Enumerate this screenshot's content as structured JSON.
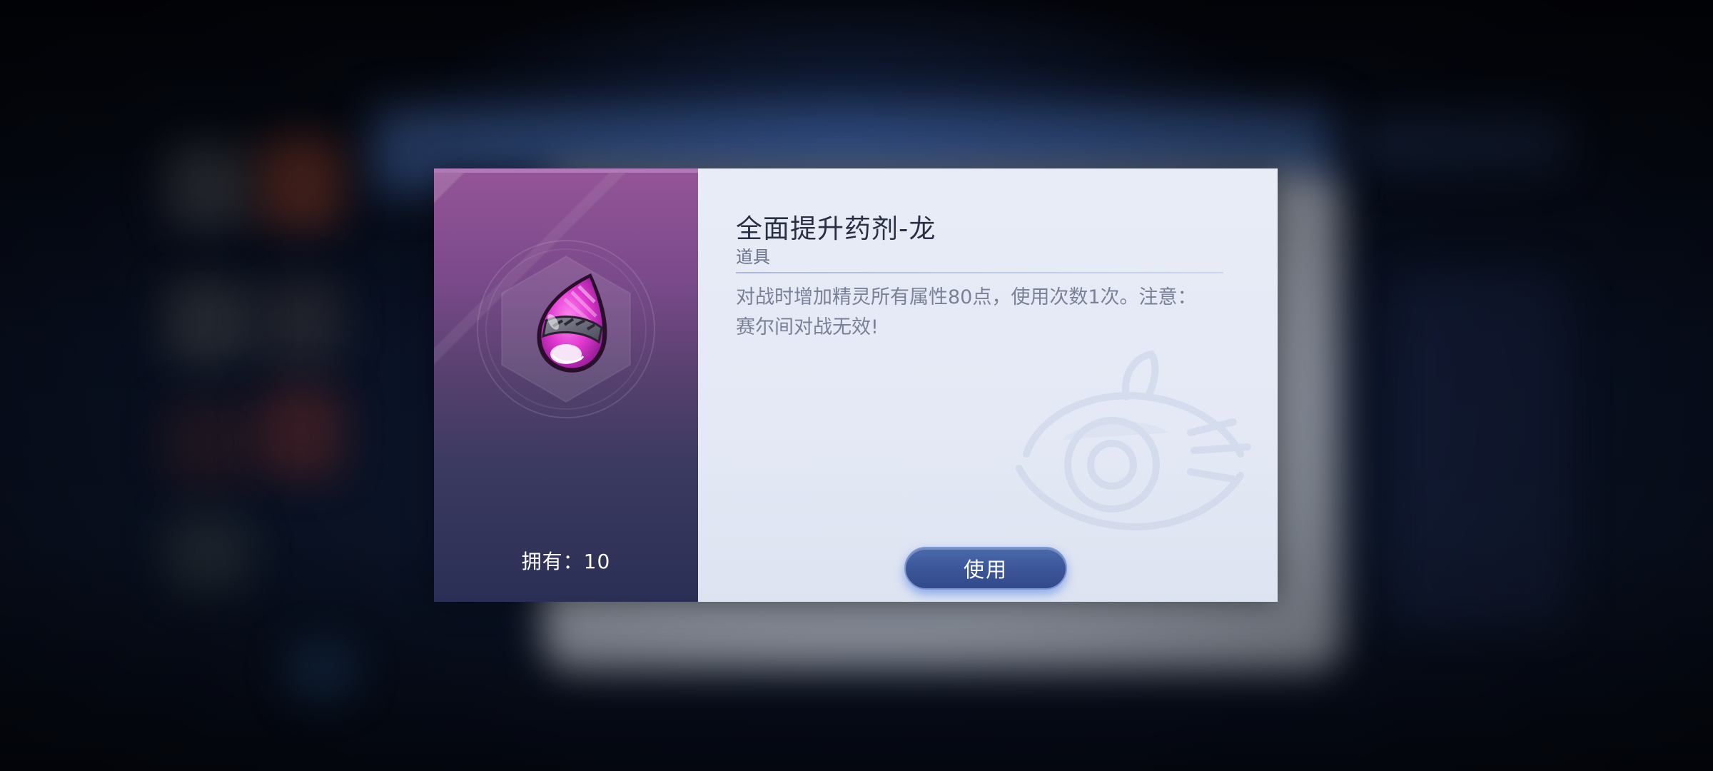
{
  "item": {
    "name": "全面提升药剂-龙",
    "category": "道具",
    "description": "对战时增加精灵所有属性80点，使用次数1次。注意：赛尔间对战无效!",
    "owned_text": "拥有：10",
    "icon": "pink-potion-drop-icon"
  },
  "actions": {
    "use_label": "使用"
  },
  "colors": {
    "item_panel_top": "#935497",
    "item_panel_bottom": "#2b2f55",
    "info_panel_bg": "#e8ecf7",
    "button_bg": "#3b5597",
    "title_text": "#2a2f44",
    "desc_text": "#7a8096"
  }
}
